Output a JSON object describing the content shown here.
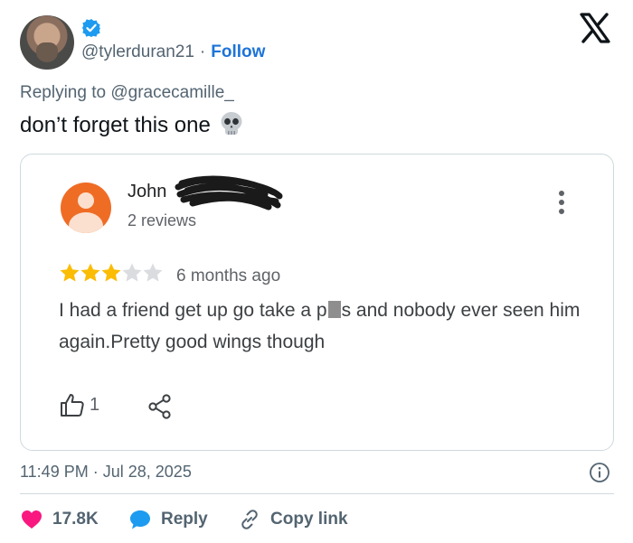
{
  "author": {
    "handle": "@tylerduran21",
    "separator": "·",
    "follow_label": "Follow"
  },
  "tweet": {
    "replying_prefix": "Replying to",
    "replying_to": "@gracecamille_",
    "text": "don’t forget this one"
  },
  "review": {
    "name": "John",
    "reviews_count": "2 reviews",
    "rating": 3,
    "max_rating": 5,
    "age": "6 months ago",
    "text_before_redaction": "I had a friend get up go take a p",
    "text_after_redaction": "s and nobody ever seen him again.Pretty good wings though",
    "likes": "1"
  },
  "meta": {
    "time": "11:49 PM",
    "separator": "·",
    "date": "Jul 28, 2025"
  },
  "actions": {
    "likes": "17.8K",
    "reply_label": "Reply",
    "copy_link_label": "Copy link"
  },
  "colors": {
    "accent": "#1d74d8",
    "heart": "#f91880",
    "reply_bubble": "#1d9bf0",
    "star_filled": "#fbbc04",
    "star_empty": "#dadce0",
    "review_avatar": "#ef6c25"
  },
  "icons": [
    "verified-badge-icon",
    "x-logo-icon",
    "skull-icon",
    "kebab-menu-icon",
    "star-icon",
    "thumbs-up-icon",
    "share-icon",
    "info-icon",
    "heart-icon",
    "reply-icon",
    "link-icon"
  ]
}
